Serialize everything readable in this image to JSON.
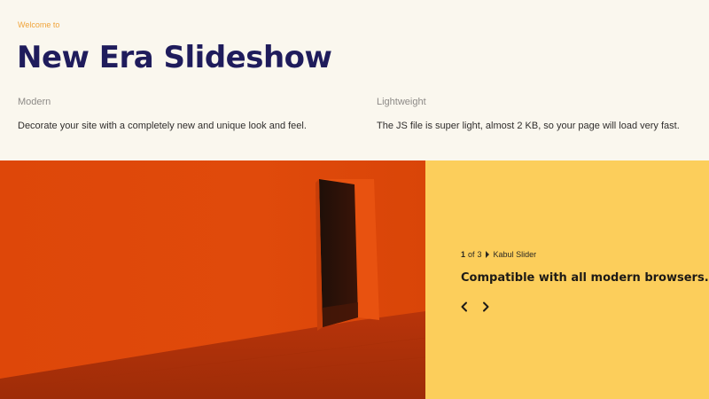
{
  "hero": {
    "eyebrow": "Welcome to",
    "title": "New Era Slideshow",
    "features": [
      {
        "heading": "Modern",
        "text": "Decorate your site with a completely new and unique look and feel."
      },
      {
        "heading": "Lightweight",
        "text": "The JS file is super light, almost 2 KB, so your page will load very fast."
      }
    ]
  },
  "slider": {
    "current": "1",
    "of_label": "of",
    "total": "3",
    "slider_name": "Kabul Slider",
    "caption": "Compatible with all modern browsers.",
    "prev_icon": "chevron-left-icon",
    "next_icon": "chevron-right-icon",
    "image_subject": "orange gallery wall with dark doorway"
  },
  "colors": {
    "background": "#faf7ee",
    "accent": "#f0a43b",
    "title": "#1f1c5c",
    "panel": "#fcce5b",
    "wall": "#e04a0b"
  }
}
